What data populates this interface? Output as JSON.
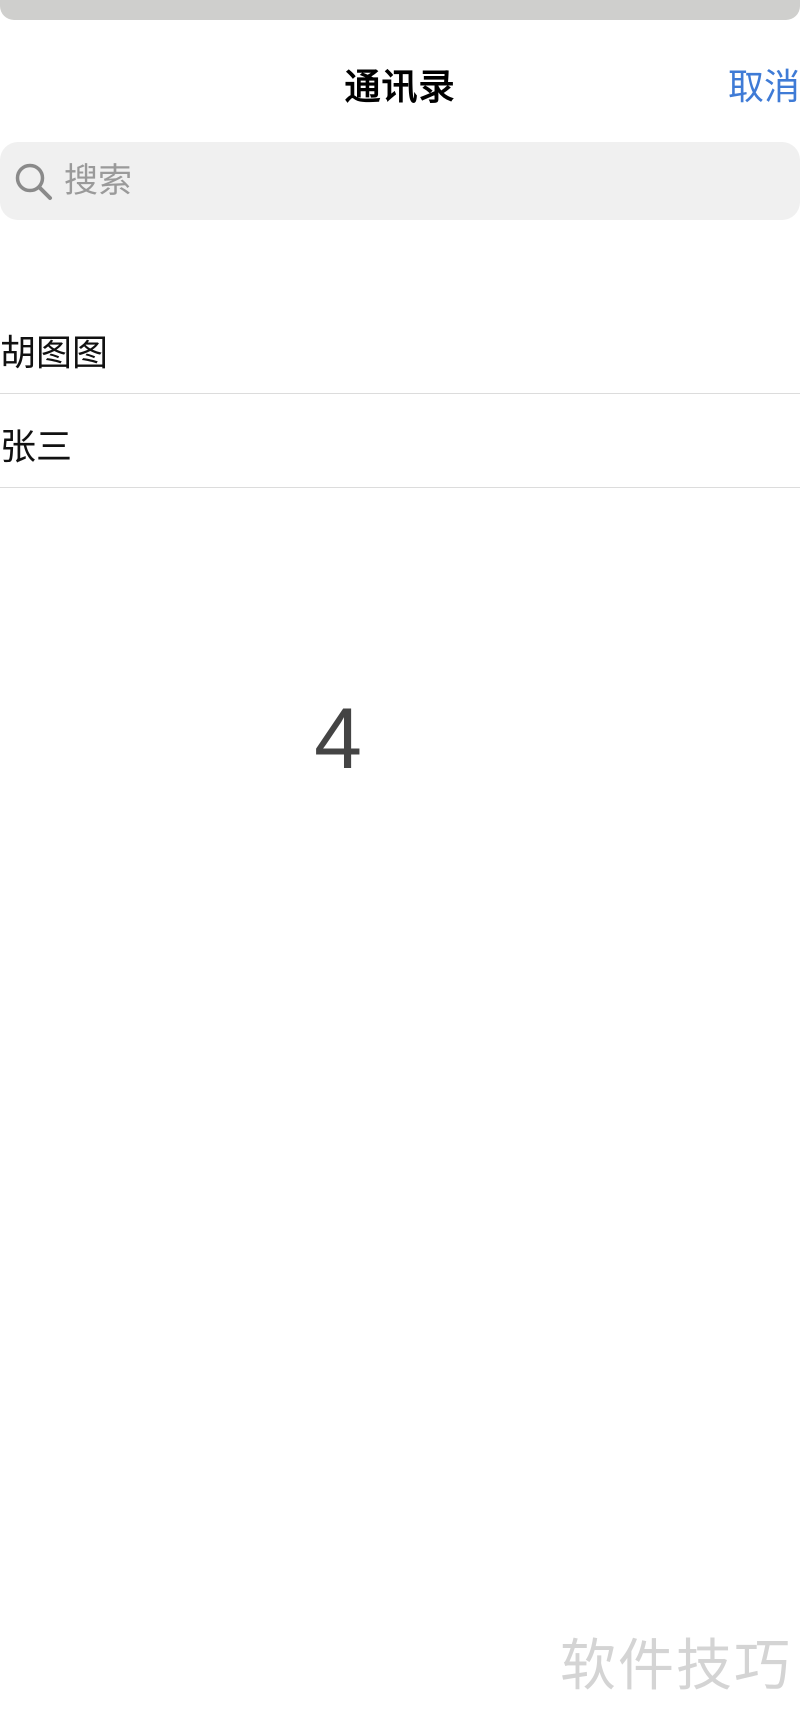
{
  "header": {
    "title": "通讯录",
    "cancel_label": "取消"
  },
  "search": {
    "placeholder": "搜索",
    "value": ""
  },
  "contacts": [
    {
      "name": "胡图图"
    },
    {
      "name": "张三"
    }
  ],
  "overlay": {
    "number": "4"
  },
  "watermark": {
    "text": "软件技巧"
  },
  "colors": {
    "accent": "#3f7bd6",
    "search_bg": "#f0f0f0",
    "divider": "#dcdcdc"
  },
  "icons": {
    "search": "search-icon"
  }
}
